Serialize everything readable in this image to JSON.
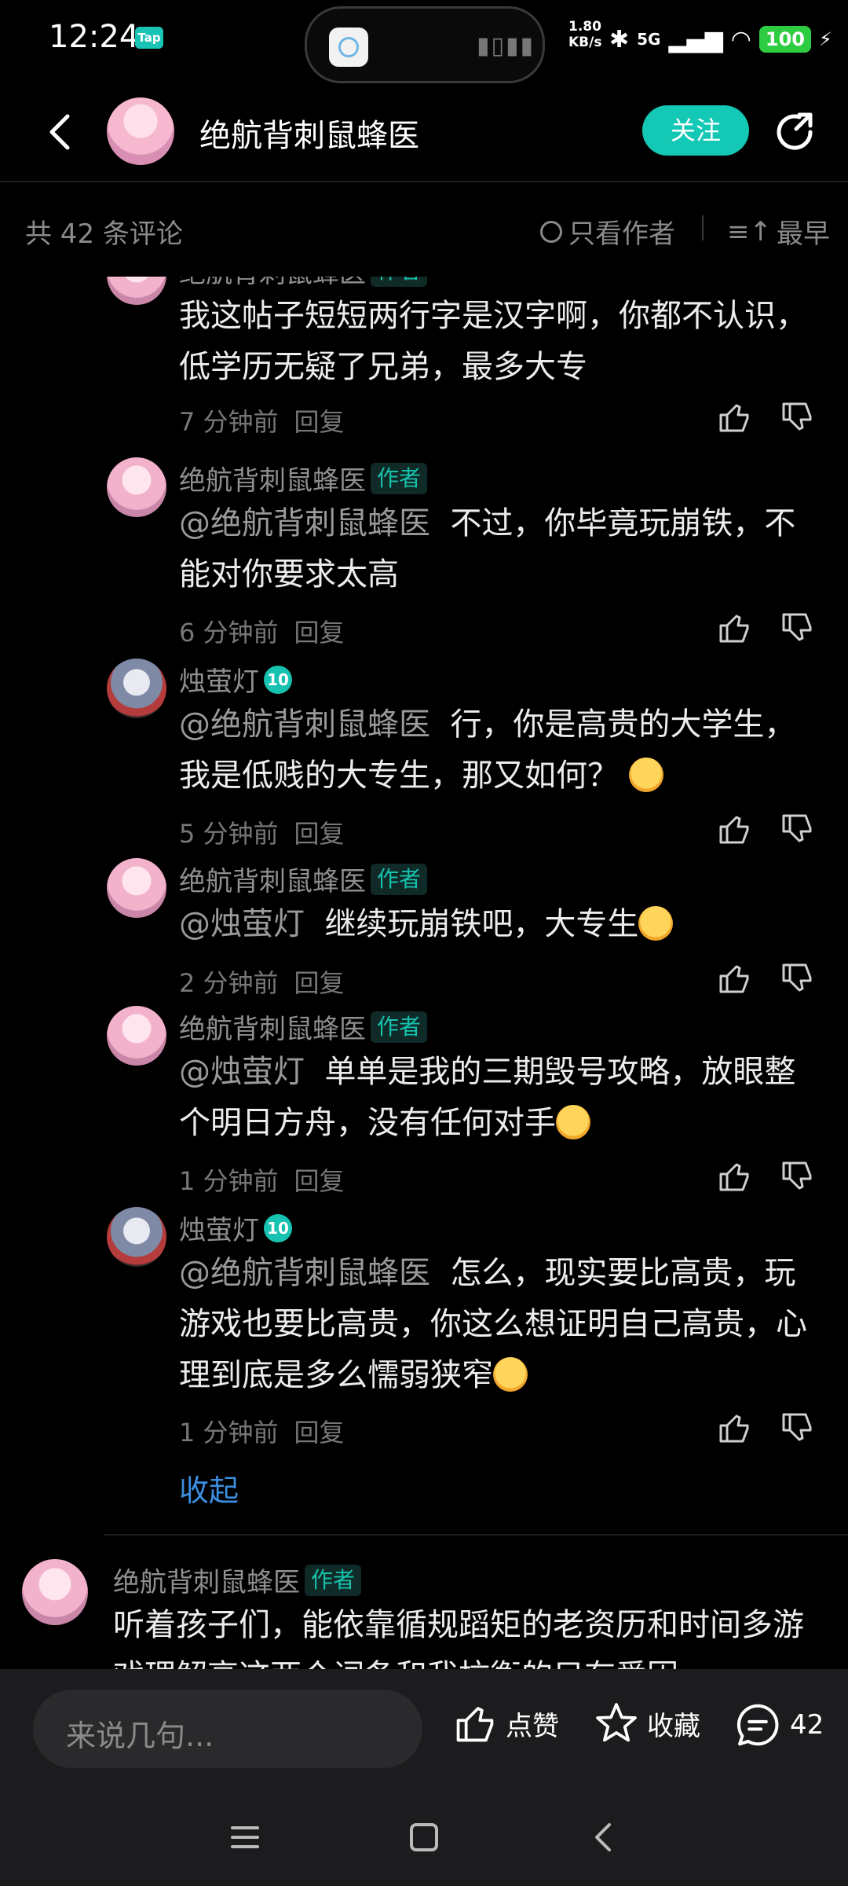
{
  "status_bar": {
    "time": "12:24",
    "app_badge": "Tap",
    "net_speed_value": "1.80",
    "net_speed_unit": "KB/s",
    "signal": "5G",
    "battery": "100"
  },
  "header": {
    "title": "绝航背刺鼠蜂医",
    "follow_label": "关注"
  },
  "sort_bar": {
    "count": "共 42 条评论",
    "only_author": "只看作者",
    "order": "最早"
  },
  "replies": [
    {
      "name": "绝航背刺鼠蜂医",
      "tag": "作者",
      "text": "我这帖子短短两行字是汉字啊，你都不认识，低学历无疑了兄弟，最多大专",
      "time": "7 分钟前",
      "reply": "回复"
    },
    {
      "name": "绝航背刺鼠蜂医",
      "tag": "作者",
      "mention": "@绝航背刺鼠蜂医",
      "text": "不过，你毕竟玩崩铁，不能对你要求太高",
      "time": "6 分钟前",
      "reply": "回复"
    },
    {
      "name": "烛萤灯",
      "level": "10",
      "mention": "@绝航背刺鼠蜂医",
      "text": "行，你是高贵的大学生，我是低贱的大专生，那又如何？",
      "time": "5 分钟前",
      "reply": "回复"
    },
    {
      "name": "绝航背刺鼠蜂医",
      "tag": "作者",
      "mention": "@烛萤灯",
      "text": "继续玩崩铁吧，大专生",
      "time": "2 分钟前",
      "reply": "回复"
    },
    {
      "name": "绝航背刺鼠蜂医",
      "tag": "作者",
      "mention": "@烛萤灯",
      "text": "单单是我的三期毁号攻略，放眼整个明日方舟，没有任何对手",
      "time": "1 分钟前",
      "reply": "回复"
    },
    {
      "name": "烛萤灯",
      "level": "10",
      "mention": "@绝航背刺鼠蜂医",
      "text": "怎么，现实要比高贵，玩游戏也要比高贵，你这么想证明自己高贵，心理到底是多么懦弱狭窄",
      "time": "1 分钟前",
      "reply": "回复"
    }
  ],
  "collapse_label": "收起",
  "top_comment": {
    "name": "绝航背刺鼠蜂医",
    "tag": "作者",
    "text": "听着孩子们，能依靠循规蹈矩的老资历和时间多游戏理解高这两个词条和我抗衡的只有爱因"
  },
  "bottom_bar": {
    "input_placeholder": "来说几句...",
    "like_label": "点赞",
    "favorite_label": "收藏",
    "comment_count": "42"
  },
  "colors": {
    "accent": "#14c8b6",
    "link": "#3b8ee0",
    "background": "#000000"
  }
}
